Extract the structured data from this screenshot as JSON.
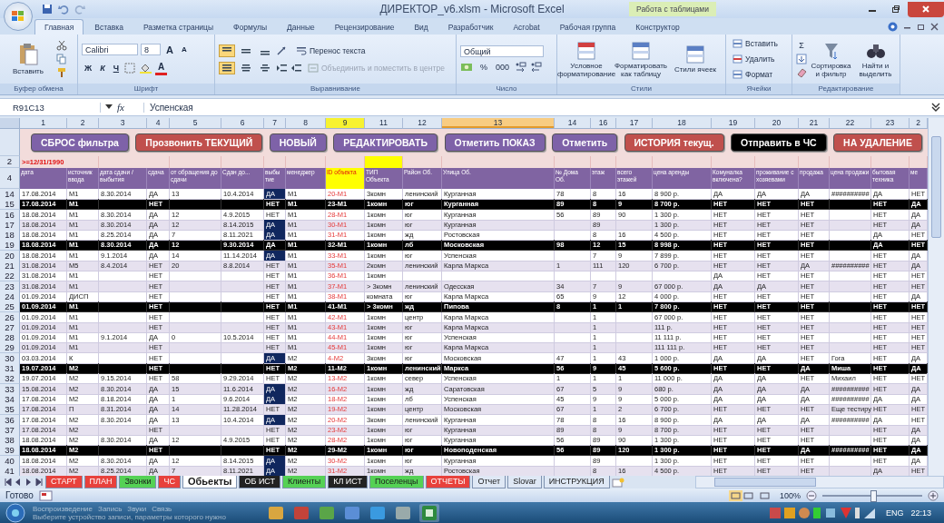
{
  "window": {
    "title": "ДИРЕКТОР_v6.xlsm - Microsoft Excel",
    "context_tab": "Работа с таблицами"
  },
  "ribbon_tabs": [
    {
      "label": "Главная",
      "selected": true
    },
    {
      "label": "Вставка",
      "selected": false
    },
    {
      "label": "Разметка страницы",
      "selected": false
    },
    {
      "label": "Формулы",
      "selected": false
    },
    {
      "label": "Данные",
      "selected": false
    },
    {
      "label": "Рецензирование",
      "selected": false
    },
    {
      "label": "Вид",
      "selected": false
    },
    {
      "label": "Разработчик",
      "selected": false
    },
    {
      "label": "Acrobat",
      "selected": false
    },
    {
      "label": "Рабочая группа",
      "selected": false
    },
    {
      "label": "Конструктор",
      "selected": false
    }
  ],
  "clipboard": {
    "paste": "Вставить",
    "label": "Буфер обмена"
  },
  "font": {
    "name": "Calibri",
    "size": "8",
    "grow": "A",
    "shrink": "A",
    "bold": "Ж",
    "italic": "К",
    "underline": "Ч",
    "color_letter": "A",
    "label": "Шрифт"
  },
  "alignment": {
    "vertical_align": [
      {
        "selected": true
      },
      {
        "selected": false
      },
      {
        "selected": false
      }
    ],
    "horizontal_align": [
      {
        "selected": true
      },
      {
        "selected": false
      },
      {
        "selected": false
      }
    ],
    "wrap": "Перенос текста",
    "merge": "Объединить и поместить в центре",
    "merge_disabled": true,
    "label": "Выравнивание"
  },
  "number": {
    "format": "Общий",
    "percent": "%",
    "thousands": "000",
    "label": "Число"
  },
  "styles": {
    "items": [
      "Условное форматирование",
      "Форматировать как таблицу",
      "Стили ячеек"
    ],
    "label": "Стили"
  },
  "cells": {
    "items": [
      "Вставить",
      "Удалить",
      "Формат"
    ],
    "label": "Ячейки"
  },
  "editing": {
    "sum": "Σ",
    "items": [
      "Сортировка и фильтр",
      "Найти и выделить"
    ],
    "label": "Редактирование"
  },
  "formula_bar": {
    "name_box": "R91C13",
    "fx": "fx",
    "value": "Успенская"
  },
  "columns": [
    {
      "label": "1",
      "selected": false,
      "highlighted": false
    },
    {
      "label": "2",
      "selected": false,
      "highlighted": false
    },
    {
      "label": "3",
      "selected": false,
      "highlighted": false
    },
    {
      "label": "4",
      "selected": false,
      "highlighted": false
    },
    {
      "label": "5",
      "selected": false,
      "highlighted": false
    },
    {
      "label": "6",
      "selected": false,
      "highlighted": false
    },
    {
      "label": "7",
      "selected": false,
      "highlighted": false
    },
    {
      "label": "8",
      "selected": false,
      "highlighted": false
    },
    {
      "label": "9",
      "selected": false,
      "highlighted": true
    },
    {
      "label": "11",
      "selected": false,
      "highlighted": false
    },
    {
      "label": "12",
      "selected": false,
      "highlighted": false
    },
    {
      "label": "13",
      "selected": true,
      "highlighted": false
    },
    {
      "label": "14",
      "selected": false,
      "highlighted": false
    },
    {
      "label": "16",
      "selected": false,
      "highlighted": false
    },
    {
      "label": "17",
      "selected": false,
      "highlighted": false
    },
    {
      "label": "18",
      "selected": false,
      "highlighted": false
    },
    {
      "label": "19",
      "selected": false,
      "highlighted": false
    },
    {
      "label": "20",
      "selected": false,
      "highlighted": false
    },
    {
      "label": "21",
      "selected": false,
      "highlighted": false
    },
    {
      "label": "22",
      "selected": false,
      "highlighted": false
    },
    {
      "label": "23",
      "selected": false,
      "highlighted": false
    },
    {
      "label": "2",
      "selected": false,
      "highlighted": false
    }
  ],
  "sheet_buttons": [
    {
      "label": "СБРОС фильтра",
      "color": "#7e62a8"
    },
    {
      "label": "Прозвонить ТЕКУЩИЙ",
      "color": "#c0504d"
    },
    {
      "label": "НОВЫЙ",
      "color": "#7e62a8"
    },
    {
      "label": "РЕДАКТИРОВАТЬ",
      "color": "#7e62a8"
    },
    {
      "label": "Отметить ПОКАЗ",
      "color": "#7e62a8"
    },
    {
      "label": "Отметить",
      "color": "#7e62a8"
    },
    {
      "label": "ИСТОРИЯ текущ.",
      "color": "#c0504d"
    },
    {
      "label": "Отправить в ЧС",
      "color": "#000000"
    },
    {
      "label": "НА УДАЛЕНИЕ",
      "color": "#c0504d"
    }
  ],
  "filter_row": {
    "number": "2",
    "criterion": ">=12/31/1990"
  },
  "header_row": {
    "number": "4",
    "headers": [
      "дата",
      "источник ввода",
      "дата сдачи / выбытия",
      "сдача",
      "от обращения до сдачи",
      "Сдан до...",
      "выбы тие",
      "менеджер",
      "ID объекта",
      "ТИП Объекта",
      "Район Об.",
      "Улица Об.",
      "№ Дома Об.",
      "этаж",
      "всего этажей",
      "цена аренды",
      "Комуналка включена?",
      "проживание с хозяевами",
      "продажа",
      "цена продажи",
      "бытовая техника",
      "ме"
    ]
  },
  "rows": [
    {
      "number": "14",
      "highlighted": false,
      "departure_marked": true,
      "cells": [
        "17.08.2014",
        "М1",
        "8.30.2014",
        "ДА",
        "13",
        "10.4.2014",
        "ДА",
        "М1",
        "20-М1",
        "3комн",
        "ленинский",
        "Курганная",
        "78",
        "8",
        "16",
        "8 900 р.",
        "ДА",
        "ДА",
        "ДА",
        "##########",
        "ДА",
        "НЕТ"
      ]
    },
    {
      "number": "15",
      "highlighted": true,
      "departure_marked": false,
      "cells": [
        "17.08.2014",
        "М1",
        null,
        "НЕТ",
        null,
        null,
        "НЕТ",
        "М1",
        "23-М1",
        "1комн",
        "юг",
        "Курганная",
        "89",
        "8",
        "9",
        "8 700 р.",
        "НЕТ",
        "НЕТ",
        "НЕТ",
        null,
        "НЕТ",
        "ДА"
      ]
    },
    {
      "number": "16",
      "highlighted": false,
      "departure_marked": false,
      "cells": [
        "18.08.2014",
        "М1",
        "8.30.2014",
        "ДА",
        "12",
        "4.9.2015",
        "НЕТ",
        "М1",
        "28-М1",
        "1комн",
        "юг",
        "Курганная",
        "56",
        "89",
        "90",
        "1 300 р.",
        "НЕТ",
        "НЕТ",
        "НЕТ",
        null,
        "НЕТ",
        "ДА"
      ]
    },
    {
      "number": "17",
      "highlighted": false,
      "departure_marked": true,
      "cells": [
        "18.08.2014",
        "М1",
        "8.30.2014",
        "ДА",
        "12",
        "8.14.2015",
        "ДА",
        "М1",
        "30-М1",
        "1комн",
        "юг",
        "Курганная",
        null,
        "89",
        null,
        "1 300 р.",
        "НЕТ",
        "НЕТ",
        "НЕТ",
        null,
        "НЕТ",
        "ДА"
      ]
    },
    {
      "number": "18",
      "highlighted": false,
      "departure_marked": true,
      "cells": [
        "18.08.2014",
        "М1",
        "8.25.2014",
        "ДА",
        "7",
        "8.11.2021",
        "ДА",
        "М1",
        "31-М1",
        "1комн",
        "жд",
        "Ростовская",
        null,
        "8",
        "16",
        "4 500 р.",
        "НЕТ",
        "НЕТ",
        "НЕТ",
        null,
        "ДА",
        "НЕТ"
      ]
    },
    {
      "number": "19",
      "highlighted": true,
      "departure_marked": false,
      "cells": [
        "18.08.2014",
        "М1",
        "8.30.2014",
        "ДА",
        "12",
        "9.30.2014",
        "ДА",
        "М1",
        "32-М1",
        "1комн",
        "лб",
        "Московская",
        "98",
        "12",
        "15",
        "8 998 р.",
        "НЕТ",
        "НЕТ",
        "НЕТ",
        null,
        "ДА",
        "НЕТ"
      ]
    },
    {
      "number": "20",
      "highlighted": false,
      "departure_marked": true,
      "cells": [
        "18.08.2014",
        "М1",
        "9.1.2014",
        "ДА",
        "14",
        "11.14.2014",
        "ДА",
        "М1",
        "33-М1",
        "1комн",
        "юг",
        "Успенская",
        null,
        "7",
        "9",
        "7 899 р.",
        "НЕТ",
        "НЕТ",
        "НЕТ",
        null,
        "НЕТ",
        "ДА"
      ]
    },
    {
      "number": "21",
      "highlighted": false,
      "departure_marked": false,
      "cells": [
        "31.08.2014",
        "М5",
        "8.4.2014",
        "НЕТ",
        "20",
        "8.8.2014",
        "НЕТ",
        "М1",
        "35-М1",
        "2комн",
        "ленинский",
        "Карла Маркса",
        "1",
        "111",
        "120",
        "6 700 р.",
        "НЕТ",
        "НЕТ",
        "ДА",
        "##########",
        "НЕТ",
        "ДА"
      ]
    },
    {
      "number": "22",
      "highlighted": false,
      "departure_marked": false,
      "cells": [
        "31.08.2014",
        "М1",
        null,
        "НЕТ",
        null,
        null,
        "НЕТ",
        "М1",
        "36-М1",
        "1комн",
        null,
        null,
        null,
        null,
        null,
        null,
        "ДА",
        "НЕТ",
        "НЕТ",
        null,
        "НЕТ",
        "НЕТ"
      ]
    },
    {
      "number": "23",
      "highlighted": false,
      "departure_marked": false,
      "cells": [
        "31.08.2014",
        "М1",
        null,
        "НЕТ",
        null,
        null,
        "НЕТ",
        "М1",
        "37-М1",
        "> 3комн",
        "ленинский",
        "Одесская",
        "34",
        "7",
        "9",
        "67 000 р.",
        "ДА",
        "ДА",
        "НЕТ",
        null,
        "НЕТ",
        "НЕТ"
      ]
    },
    {
      "number": "24",
      "highlighted": false,
      "departure_marked": false,
      "cells": [
        "01.09.2014",
        "ДИСП",
        null,
        "НЕТ",
        null,
        null,
        "НЕТ",
        "М1",
        "38-М1",
        "комната",
        "юг",
        "Карла Маркса",
        "65",
        "9",
        "12",
        "4 000 р.",
        "НЕТ",
        "НЕТ",
        "НЕТ",
        null,
        "НЕТ",
        "ДА"
      ]
    },
    {
      "number": "25",
      "highlighted": true,
      "departure_marked": false,
      "cells": [
        "01.09.2014",
        "М1",
        null,
        "НЕТ",
        null,
        null,
        "НЕТ",
        "М1",
        "41-М1",
        "> 3комн",
        "жд",
        "Пипова",
        "8",
        "1",
        "1",
        "7 800 р.",
        "НЕТ",
        "НЕТ",
        "НЕТ",
        null,
        "НЕТ",
        "НЕТ"
      ]
    },
    {
      "number": "26",
      "highlighted": false,
      "departure_marked": false,
      "cells": [
        "01.09.2014",
        "М1",
        null,
        "НЕТ",
        null,
        null,
        "НЕТ",
        "М1",
        "42-М1",
        "1комн",
        "центр",
        "Карла Маркса",
        null,
        "1",
        null,
        "67 000 р.",
        "НЕТ",
        "НЕТ",
        "НЕТ",
        null,
        "НЕТ",
        "НЕТ"
      ]
    },
    {
      "number": "27",
      "highlighted": false,
      "departure_marked": false,
      "cells": [
        "01.09.2014",
        "М1",
        null,
        "НЕТ",
        null,
        null,
        "НЕТ",
        "М1",
        "43-М1",
        "1комн",
        "юг",
        "Карла Маркса",
        null,
        "1",
        null,
        "111 р.",
        "НЕТ",
        "НЕТ",
        "НЕТ",
        null,
        "НЕТ",
        "НЕТ"
      ]
    },
    {
      "number": "28",
      "highlighted": false,
      "departure_marked": false,
      "cells": [
        "01.09.2014",
        "М1",
        "9.1.2014",
        "ДА",
        "0",
        "10.5.2014",
        "НЕТ",
        "М1",
        "44-М1",
        "1комн",
        "юг",
        "Успенская",
        null,
        "1",
        null,
        "11 111 р.",
        "НЕТ",
        "НЕТ",
        "НЕТ",
        null,
        "НЕТ",
        "НЕТ"
      ]
    },
    {
      "number": "29",
      "highlighted": false,
      "departure_marked": false,
      "cells": [
        "01.09.2014",
        "М1",
        null,
        "НЕТ",
        null,
        null,
        "НЕТ",
        "М1",
        "45-М1",
        "1комн",
        "юг",
        "Карла Маркса",
        null,
        "1",
        null,
        "111 111 р.",
        "НЕТ",
        "НЕТ",
        "НЕТ",
        null,
        "НЕТ",
        "НЕТ"
      ]
    },
    {
      "number": "30",
      "highlighted": false,
      "departure_marked": true,
      "cells": [
        "03.03.2014",
        "К",
        null,
        "НЕТ",
        null,
        null,
        "ДА",
        "М2",
        "4-М2",
        "3комн",
        "юг",
        "Московская",
        "47",
        "1",
        "43",
        "1 000 р.",
        "ДА",
        "ДА",
        "НЕТ",
        "Гога",
        "НЕТ",
        "ДА"
      ]
    },
    {
      "number": "31",
      "highlighted": true,
      "departure_marked": false,
      "cells": [
        "19.07.2014",
        "М2",
        null,
        "НЕТ",
        null,
        null,
        "НЕТ",
        "М2",
        "11-М2",
        "1комн",
        "ленинский",
        "Маркса",
        "56",
        "9",
        "45",
        "5 600 р.",
        "НЕТ",
        "НЕТ",
        "ДА",
        "Миша",
        "НЕТ",
        "ДА"
      ]
    },
    {
      "number": "32",
      "highlighted": false,
      "departure_marked": false,
      "cells": [
        "19.07.2014",
        "М2",
        "9.15.2014",
        "НЕТ",
        "58",
        "9.29.2014",
        "НЕТ",
        "М2",
        "13-М2",
        "1комн",
        "север",
        "Успенская",
        "1",
        "1",
        "1",
        "11 000 р.",
        "ДА",
        "ДА",
        "НЕТ",
        "Михаил",
        "НЕТ",
        "НЕТ"
      ]
    },
    {
      "number": "33",
      "highlighted": false,
      "departure_marked": true,
      "cells": [
        "15.08.2014",
        "М2",
        "8.30.2014",
        "ДА",
        "15",
        "11.6.2014",
        "ДА",
        "М2",
        "16-М2",
        "1комн",
        "жд",
        "Саратовская",
        "67",
        "5",
        "9",
        "680 р.",
        "ДА",
        "ДА",
        "ДА",
        "##########",
        "НЕТ",
        "ДА"
      ]
    },
    {
      "number": "34",
      "highlighted": false,
      "departure_marked": true,
      "cells": [
        "17.08.2014",
        "М2",
        "8.18.2014",
        "ДА",
        "1",
        "9.6.2014",
        "ДА",
        "М2",
        "18-М2",
        "1комн",
        "лб",
        "Успенская",
        "45",
        "9",
        "9",
        "5 000 р.",
        "ДА",
        "ДА",
        "ДА",
        "##########",
        "ДА",
        "ДА"
      ]
    },
    {
      "number": "35",
      "highlighted": false,
      "departure_marked": false,
      "cells": [
        "17.08.2014",
        "П",
        "8.31.2014",
        "ДА",
        "14",
        "11.28.2014",
        "НЕТ",
        "М2",
        "19-М2",
        "1комн",
        "центр",
        "Московская",
        "67",
        "1",
        "2",
        "6 700 р.",
        "НЕТ",
        "НЕТ",
        "НЕТ",
        "Еще тестиру",
        "НЕТ",
        "НЕТ"
      ]
    },
    {
      "number": "36",
      "highlighted": false,
      "departure_marked": true,
      "cells": [
        "17.08.2014",
        "М2",
        "8.30.2014",
        "ДА",
        "13",
        "10.4.2014",
        "ДА",
        "М2",
        "20-М2",
        "3комн",
        "ленинский",
        "Курганная",
        "78",
        "8",
        "16",
        "8 900 р.",
        "ДА",
        "ДА",
        "ДА",
        "##########",
        "ДА",
        "НЕТ"
      ]
    },
    {
      "number": "37",
      "highlighted": false,
      "departure_marked": false,
      "cells": [
        "17.08.2014",
        "М2",
        null,
        "НЕТ",
        null,
        null,
        "НЕТ",
        "М2",
        "23-М2",
        "1комн",
        "юг",
        "Курганная",
        "89",
        "8",
        "9",
        "8 700 р.",
        "НЕТ",
        "НЕТ",
        "НЕТ",
        null,
        "НЕТ",
        "ДА"
      ]
    },
    {
      "number": "38",
      "highlighted": false,
      "departure_marked": false,
      "cells": [
        "18.08.2014",
        "М2",
        "8.30.2014",
        "ДА",
        "12",
        "4.9.2015",
        "НЕТ",
        "М2",
        "28-М2",
        "1комн",
        "юг",
        "Курганная",
        "56",
        "89",
        "90",
        "1 300 р.",
        "НЕТ",
        "НЕТ",
        "НЕТ",
        null,
        "НЕТ",
        "ДА"
      ]
    },
    {
      "number": "39",
      "highlighted": true,
      "departure_marked": false,
      "cells": [
        "18.08.2014",
        "М2",
        null,
        "НЕТ",
        null,
        null,
        "НЕТ",
        "М2",
        "29-М2",
        "1комн",
        "юг",
        "Новоподенская",
        "56",
        "89",
        "120",
        "1 300 р.",
        "НЕТ",
        "НЕТ",
        "ДА",
        "##########",
        "НЕТ",
        "ДА"
      ]
    },
    {
      "number": "40",
      "highlighted": false,
      "departure_marked": true,
      "cells": [
        "18.08.2014",
        "М2",
        "8.30.2014",
        "ДА",
        "12",
        "8.14.2015",
        "ДА",
        "М2",
        "30-М2",
        "1комн",
        "юг",
        "Курганная",
        null,
        "89",
        null,
        "1 300 р.",
        "НЕТ",
        "НЕТ",
        "НЕТ",
        null,
        "НЕТ",
        "ДА"
      ]
    },
    {
      "number": "41",
      "highlighted": false,
      "departure_marked": true,
      "cells": [
        "18.08.2014",
        "М2",
        "8.25.2014",
        "ДА",
        "7",
        "8.11.2021",
        "ДА",
        "М2",
        "31-М2",
        "1комн",
        "жд",
        "Ростовская",
        null,
        "8",
        "16",
        "4 500 р.",
        "НЕТ",
        "НЕТ",
        "НЕТ",
        null,
        "ДА",
        "НЕТ"
      ]
    }
  ],
  "sheet_tabs": [
    {
      "label": "СТАРТ",
      "selected": false,
      "color": "#e8413c"
    },
    {
      "label": "ПЛАН",
      "selected": false,
      "color": "#e8413c"
    },
    {
      "label": "Звонки",
      "selected": false,
      "color": "#55d155"
    },
    {
      "label": "ЧС",
      "selected": false,
      "color": "#e8413c"
    },
    {
      "label": "Обьекты",
      "selected": true,
      "color": "#ffffff"
    },
    {
      "label": "ОБ ИСТ",
      "selected": false,
      "color": "#222222"
    },
    {
      "label": "Клиенты",
      "selected": false,
      "color": "#55d155"
    },
    {
      "label": "КЛ ИСТ",
      "selected": false,
      "color": "#222222"
    },
    {
      "label": "Поселенцы",
      "selected": false,
      "color": "#55d155"
    },
    {
      "label": "ОТЧЕТЫ",
      "selected": false,
      "color": "#e8413c"
    },
    {
      "label": "Отчет",
      "selected": false,
      "color": "#dfe8f5"
    },
    {
      "label": "Slovar",
      "selected": false,
      "color": "#dfe8f5"
    },
    {
      "label": "ИНСТРУКЦИЯ",
      "selected": false,
      "color": "#dfe8f5"
    }
  ],
  "status_bar": {
    "status": "Готово",
    "zoom": "100%",
    "zoom_slider": {
      "level": 0.5
    }
  },
  "taskbar": {
    "ghost_tabs": [
      "Воспроизведение",
      "Запись",
      "Звуки",
      "Связь"
    ],
    "ghost_hint": "Выберите устройство записи, параметры которого нужно",
    "language": "ENG",
    "time": "22:13"
  }
}
